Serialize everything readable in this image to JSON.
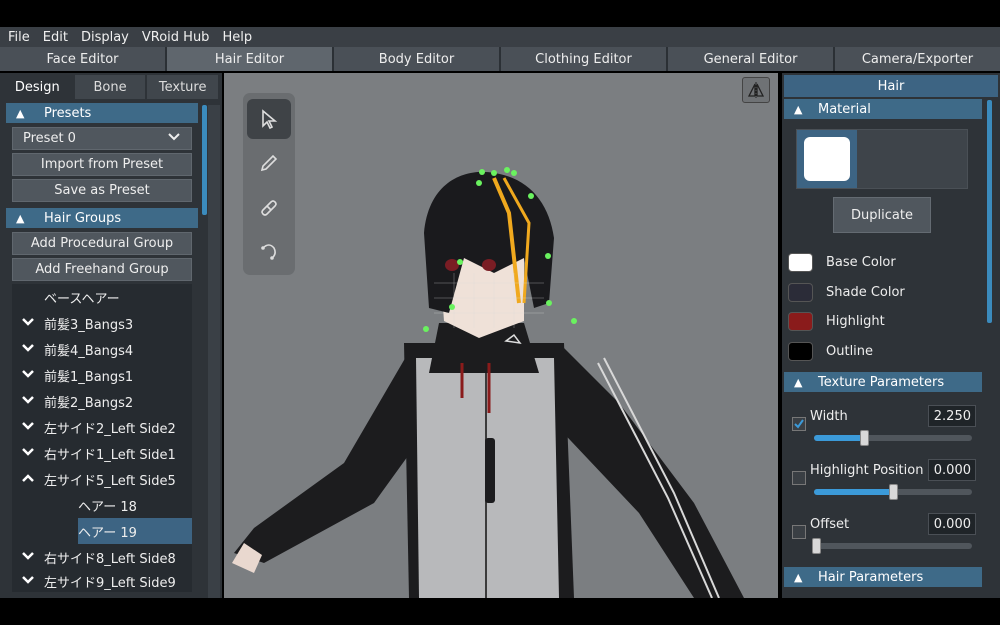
{
  "menu": [
    "File",
    "Edit",
    "Display",
    "VRoid Hub",
    "Help"
  ],
  "editor_tabs": [
    "Face Editor",
    "Hair Editor",
    "Body Editor",
    "Clothing Editor",
    "General Editor",
    "Camera/Exporter"
  ],
  "left": {
    "sub_tabs": [
      "Design",
      "Bone",
      "Texture"
    ],
    "presets": {
      "header": "Presets",
      "selected": "Preset 0",
      "import_label": "Import from Preset",
      "save_label": "Save as Preset"
    },
    "hair_groups": {
      "header": "Hair Groups",
      "add_procedural": "Add Procedural Group",
      "add_freehand": "Add Freehand Group",
      "items": [
        {
          "label": "ベースヘアー",
          "arrow": ""
        },
        {
          "label": "前髪3_Bangs3",
          "arrow": "down"
        },
        {
          "label": "前髪4_Bangs4",
          "arrow": "down"
        },
        {
          "label": "前髪1_Bangs1",
          "arrow": "down"
        },
        {
          "label": "前髪2_Bangs2",
          "arrow": "down"
        },
        {
          "label": "左サイド2_Left Side2",
          "arrow": "down"
        },
        {
          "label": "右サイド1_Left Side1",
          "arrow": "down"
        },
        {
          "label": "左サイド5_Left Side5",
          "arrow": "up"
        },
        {
          "label": "ヘアー 18",
          "arrow": "child"
        },
        {
          "label": "ヘアー 19",
          "arrow": "child-selected"
        },
        {
          "label": "右サイド8_Left Side8",
          "arrow": "down"
        },
        {
          "label": "左サイド9_Left Side9",
          "arrow": "down"
        }
      ]
    }
  },
  "viewport": {
    "tools": [
      "select-tool",
      "pen-tool",
      "eraser-tool",
      "curve-tool"
    ]
  },
  "right": {
    "title": "Hair",
    "material": {
      "header": "Material",
      "duplicate_label": "Duplicate",
      "colors": [
        {
          "label": "Base Color",
          "color": "#ffffff"
        },
        {
          "label": "Shade Color",
          "color": "#2b2c38"
        },
        {
          "label": "Highlight",
          "color": "#8a1b1b"
        },
        {
          "label": "Outline",
          "color": "#000000"
        }
      ]
    },
    "texture_parameters": {
      "header": "Texture Parameters",
      "params": [
        {
          "label": "Width",
          "value": "2.250",
          "checked": true,
          "fraction": 0.32
        },
        {
          "label": "Highlight Position",
          "value": "0.000",
          "checked": false,
          "fraction": 0.5
        },
        {
          "label": "Offset",
          "value": "0.000",
          "checked": false,
          "fraction": 0.0
        }
      ]
    },
    "hair_parameters": {
      "header": "Hair Parameters"
    }
  }
}
